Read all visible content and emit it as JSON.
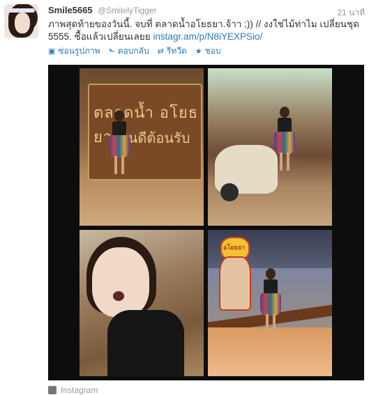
{
  "tweet": {
    "name": "Smile5665",
    "handle": "@SmilelyTigger",
    "time": "21 นาที",
    "text_main": "ภาพสุดท้ายของวันนี้. จบที่ ตลาดน้ำอโยธยา.จ้าา ;)) // งงใช่ไม้ท่าไม เปลี่ยนชุด 5555. ซื้อแล้วเปลี่ยนเลยย ",
    "text_link": "instagr.am/p/N8iYEXPSio/"
  },
  "actions": {
    "hide_photo": "ซ่อนรูปภาพ",
    "reply": "ตอบกลับ",
    "retweet": "รีทวีต",
    "favorite": "ชอบ"
  },
  "photo": {
    "sign_line1": "ตลาดน้ำ อโยธยา",
    "sign_line2": "ยินดีต้อนรับ",
    "cow_label": "อโยธยา"
  },
  "footer": {
    "source": "Instagram"
  },
  "colors": {
    "link": "#2b7bb9",
    "muted": "#999999",
    "text": "#333333"
  }
}
